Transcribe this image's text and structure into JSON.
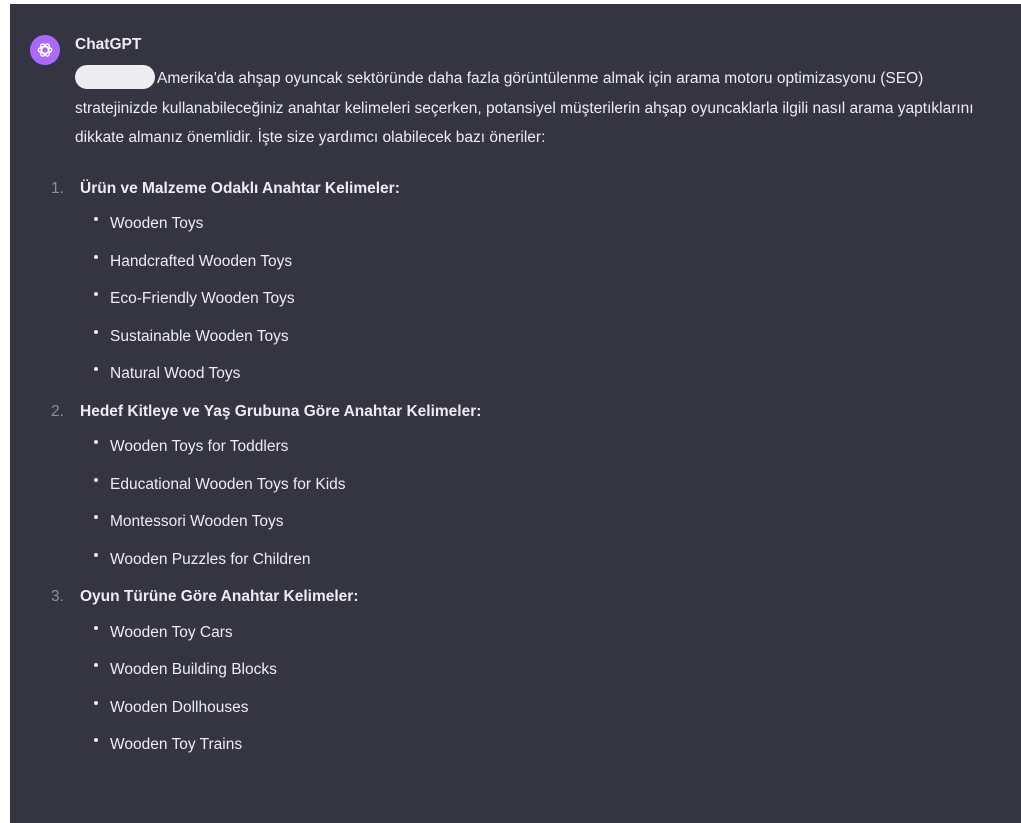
{
  "message": {
    "author": "ChatGPT",
    "avatar_icon": "openai-logo-icon",
    "avatar_color": "#ab68ff",
    "intro": "Amerika'da ahşap oyuncak sektöründe daha fazla görüntülenme almak için arama motoru optimizasyonu (SEO) stratejinizde kullanabileceğiniz anahtar kelimeleri seçerken, potansiyel müşterilerin ahşap oyuncaklarla ilgili nasıl arama yaptıklarını dikkate almanız önemlidir. İşte size yardımcı olabilecek bazı öneriler:",
    "sections": [
      {
        "number": "1.",
        "heading": "Ürün ve Malzeme Odaklı Anahtar Kelimeler:",
        "items": [
          "Wooden Toys",
          "Handcrafted Wooden Toys",
          "Eco-Friendly Wooden Toys",
          "Sustainable Wooden Toys",
          "Natural Wood Toys"
        ]
      },
      {
        "number": "2.",
        "heading": "Hedef Kitleye ve Yaş Grubuna Göre Anahtar Kelimeler:",
        "items": [
          "Wooden Toys for Toddlers",
          "Educational Wooden Toys for Kids",
          "Montessori Wooden Toys",
          "Wooden Puzzles for Children"
        ]
      },
      {
        "number": "3.",
        "heading": "Oyun Türüne Göre Anahtar Kelimeler:",
        "items": [
          "Wooden Toy Cars",
          "Wooden Building Blocks",
          "Wooden Dollhouses",
          "Wooden Toy Trains"
        ]
      }
    ]
  },
  "colors": {
    "background": "#343541",
    "text": "#ececf1",
    "muted": "#8e8ea0"
  }
}
